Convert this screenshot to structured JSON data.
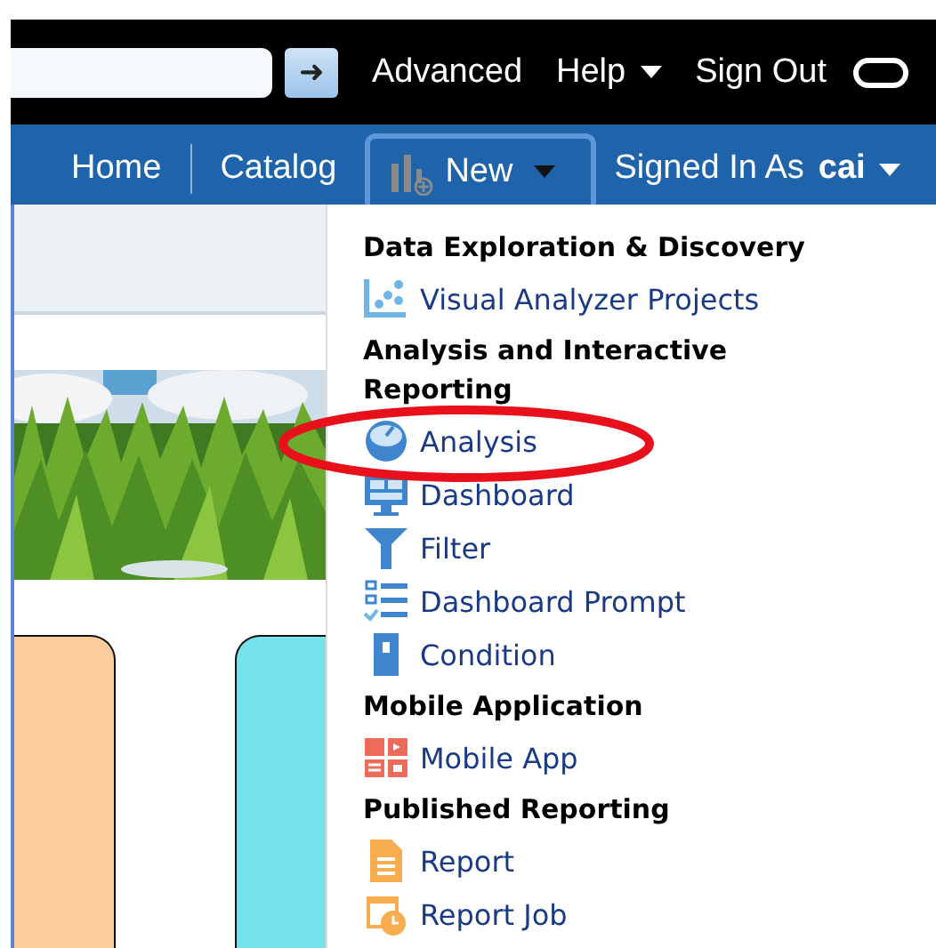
{
  "top_bar": {
    "search_button": "➜",
    "links": [
      {
        "label": "Advanced",
        "dropdown": false
      },
      {
        "label": "Help",
        "dropdown": true
      },
      {
        "label": "Sign Out",
        "dropdown": false
      }
    ]
  },
  "nav_bar": {
    "items": [
      {
        "label": "Home",
        "selected": false,
        "dropdown": false
      },
      {
        "label": "Catalog",
        "selected": false,
        "dropdown": false
      },
      {
        "label": "New",
        "selected": true,
        "dropdown": true
      }
    ],
    "signed_in": {
      "label": "Signed In As",
      "user": "cai"
    }
  },
  "new_menu": [
    {
      "kind": "header",
      "label": "Data Exploration & Discovery"
    },
    {
      "kind": "item",
      "label": "Visual Analyzer Projects"
    },
    {
      "kind": "header",
      "label": "Analysis and Interactive Reporting"
    },
    {
      "kind": "item",
      "label": "Analysis"
    },
    {
      "kind": "item",
      "label": "Dashboard"
    },
    {
      "kind": "item",
      "label": "Filter"
    },
    {
      "kind": "item",
      "label": "Dashboard Prompt"
    },
    {
      "kind": "item",
      "label": "Condition"
    },
    {
      "kind": "header",
      "label": "Mobile Application"
    },
    {
      "kind": "item",
      "label": "Mobile App"
    },
    {
      "kind": "header",
      "label": "Published Reporting"
    },
    {
      "kind": "item",
      "label": "Report"
    },
    {
      "kind": "item",
      "label": "Report Job"
    }
  ],
  "cards": [
    {
      "color": "#fccc9d"
    },
    {
      "color": "#76e3ec"
    }
  ]
}
